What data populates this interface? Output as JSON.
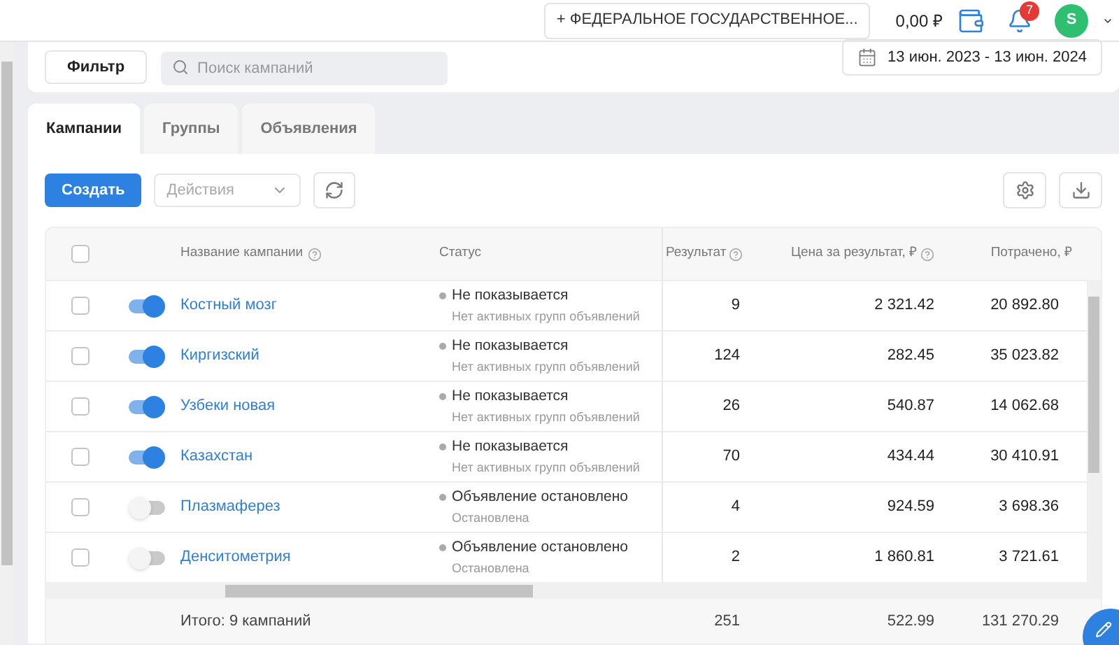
{
  "header": {
    "org_button": "+ ФЕДЕРАЛЬНОЕ ГОСУДАРСТВЕННОЕ...",
    "balance": "0,00 ₽",
    "notifications_count": "7",
    "avatar_letter": "S"
  },
  "filters": {
    "filter_button": "Фильтр",
    "search": {
      "placeholder": "Поиск кампаний"
    },
    "date_range": "13 июн. 2023 - 13 июн. 2024"
  },
  "tabs": [
    {
      "label": "Кампании",
      "selected": true
    },
    {
      "label": "Группы",
      "selected": false
    },
    {
      "label": "Объявления",
      "selected": false
    }
  ],
  "toolbar": {
    "create_button": "Создать",
    "actions": {
      "placeholder": "Действия"
    }
  },
  "table": {
    "columns": [
      "Название кампании",
      "Статус",
      "Результат",
      "Цена за результат, ₽",
      "Потрачено, ₽"
    ],
    "header_checked": false,
    "rows": [
      {
        "checked": false,
        "on": true,
        "name": "Костный мозг",
        "status": "Не показывается",
        "status_note": "Нет активных групп объявлений",
        "result": "9",
        "price": "2 321.42",
        "spent": "20 892.80"
      },
      {
        "checked": false,
        "on": true,
        "name": "Киргизский",
        "status": "Не показывается",
        "status_note": "Нет активных групп объявлений",
        "result": "124",
        "price": "282.45",
        "spent": "35 023.82"
      },
      {
        "checked": false,
        "on": true,
        "name": "Узбеки новая",
        "status": "Не показывается",
        "status_note": "Нет активных групп объявлений",
        "result": "26",
        "price": "540.87",
        "spent": "14 062.68"
      },
      {
        "checked": false,
        "on": true,
        "name": "Казахстан",
        "status": "Не показывается",
        "status_note": "Нет активных групп объявлений",
        "result": "70",
        "price": "434.44",
        "spent": "30 410.91"
      },
      {
        "checked": false,
        "on": false,
        "name": "Плазмаферез",
        "status": "Объявление остановлено",
        "status_note": "Остановлена",
        "result": "4",
        "price": "924.59",
        "spent": "3 698.36"
      },
      {
        "checked": false,
        "on": false,
        "name": "Денситометрия",
        "status": "Объявление остановлено",
        "status_note": "Остановлена",
        "result": "2",
        "price": "1 860.81",
        "spent": "3 721.61"
      }
    ],
    "footer": {
      "total_label": "Итого: 9 кампаний",
      "result": "251",
      "price": "522.99",
      "spent": "131 270.29"
    }
  }
}
